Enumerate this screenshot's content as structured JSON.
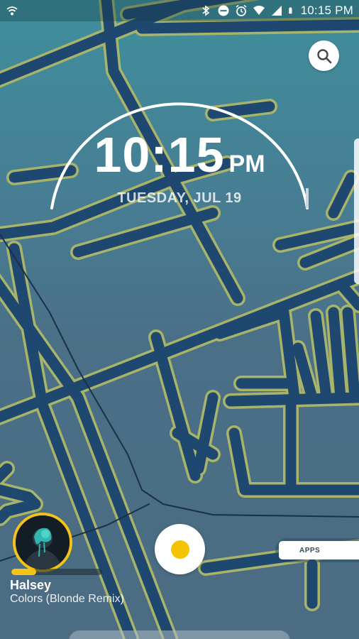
{
  "status_bar": {
    "time": "10:15 PM",
    "icons": [
      "wifi-call-icon",
      "bluetooth-icon",
      "do-not-disturb-icon",
      "alarm-icon",
      "wifi-icon",
      "signal-icon",
      "battery-icon"
    ]
  },
  "clock": {
    "time": "10:15",
    "ampm": "PM",
    "date": "TUESDAY, JUL 19"
  },
  "music": {
    "artist": "Halsey",
    "title": "Colors (Blonde Remix)",
    "progress": 0.27
  },
  "apps_label": "APPS",
  "colors": {
    "accent": "#f3c316",
    "road": "#1f4870",
    "road_outline": "#a8b46a"
  }
}
